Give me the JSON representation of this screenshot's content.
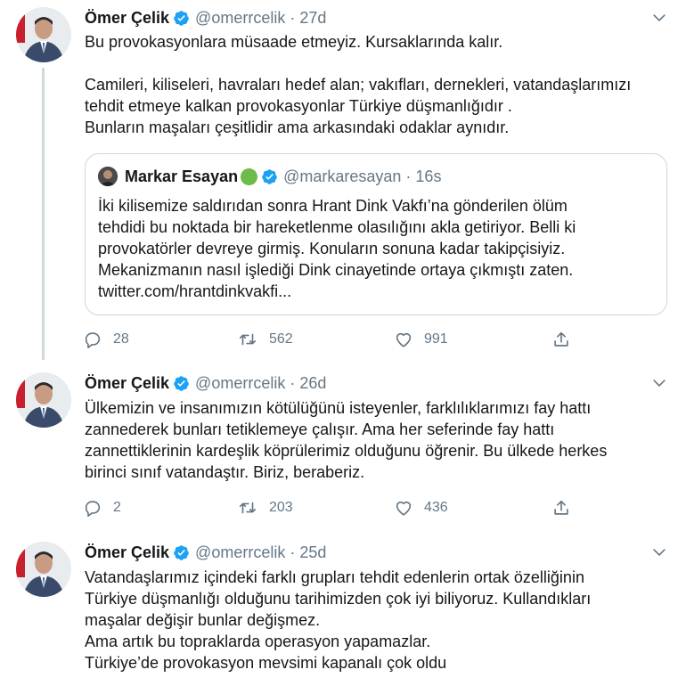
{
  "tweets": [
    {
      "name": "Ömer Çelik",
      "handle": "@omerrcelik",
      "sep": "·",
      "time": "27d",
      "paragraphs": [
        "Bu provokasyonlara müsaade etmeyiz. Kursaklarında kalır.",
        "Camileri, kiliseleri, havraları hedef alan; vakıfları, dernekleri, vatandaşlarımızı tehdit etmeye kalkan provokasyonlar Türkiye düşmanlığıdır .",
        "Bunların maşaları çeşitlidir ama arkasındaki odaklar aynıdır."
      ],
      "quote": {
        "name": "Markar Esayan",
        "handle": "@markaresayan",
        "sep": "·",
        "time": "16s",
        "lines": [
          "İki kilisemize saldırıdan sonra Hrant Dink Vakfı’na gönderilen ölüm",
          "tehdidi bu noktada bir hareketlenme olasılığını akla getiriyor. Belli ki",
          "provokatörler devreye girmiş. Konuların sonuna kadar takipçisiyiz.",
          "Mekanizmanın nasıl işlediği Dink cinayetinde ortaya çıkmıştı zaten.",
          "twitter.com/hrantdinkvakfi..."
        ]
      },
      "replies": "28",
      "retweets": "562",
      "likes": "991"
    },
    {
      "name": "Ömer Çelik",
      "handle": "@omerrcelik",
      "sep": "·",
      "time": "26d",
      "lines": [
        "Ülkemizin ve insanımızın kötülüğünü isteyenler, farklılıklarımızı fay hattı",
        "zannederek bunları tetiklemeye çalışır. Ama her seferinde fay hattı",
        "zannettiklerinin kardeşlik köprülerimiz olduğunu öğrenir. Bu ülkede herkes",
        "birinci sınıf vatandaştır. Biriz, beraberiz."
      ],
      "replies": "2",
      "retweets": "203",
      "likes": "436"
    },
    {
      "name": "Ömer Çelik",
      "handle": "@omerrcelik",
      "sep": "·",
      "time": "25d",
      "lines": [
        "Vatandaşlarımız içindeki farklı grupları tehdit edenlerin ortak özelliğinin",
        "Türkiye düşmanlığı olduğunu tarihimizden çok iyi biliyoruz. Kullandıkları",
        "maşalar değişir bunlar değişmez.",
        "Ama artık bu topraklarda operasyon yapamazlar.",
        "Türkiye’de provokasyon mevsimi kapanalı çok oldu"
      ]
    }
  ],
  "colors": {
    "verified": "#1da1f2",
    "muted": "#657786",
    "border": "#ccd6dd"
  },
  "icons": [
    "verified-badge-icon",
    "chevron-down-icon",
    "reply-icon",
    "retweet-icon",
    "like-icon",
    "share-icon"
  ]
}
